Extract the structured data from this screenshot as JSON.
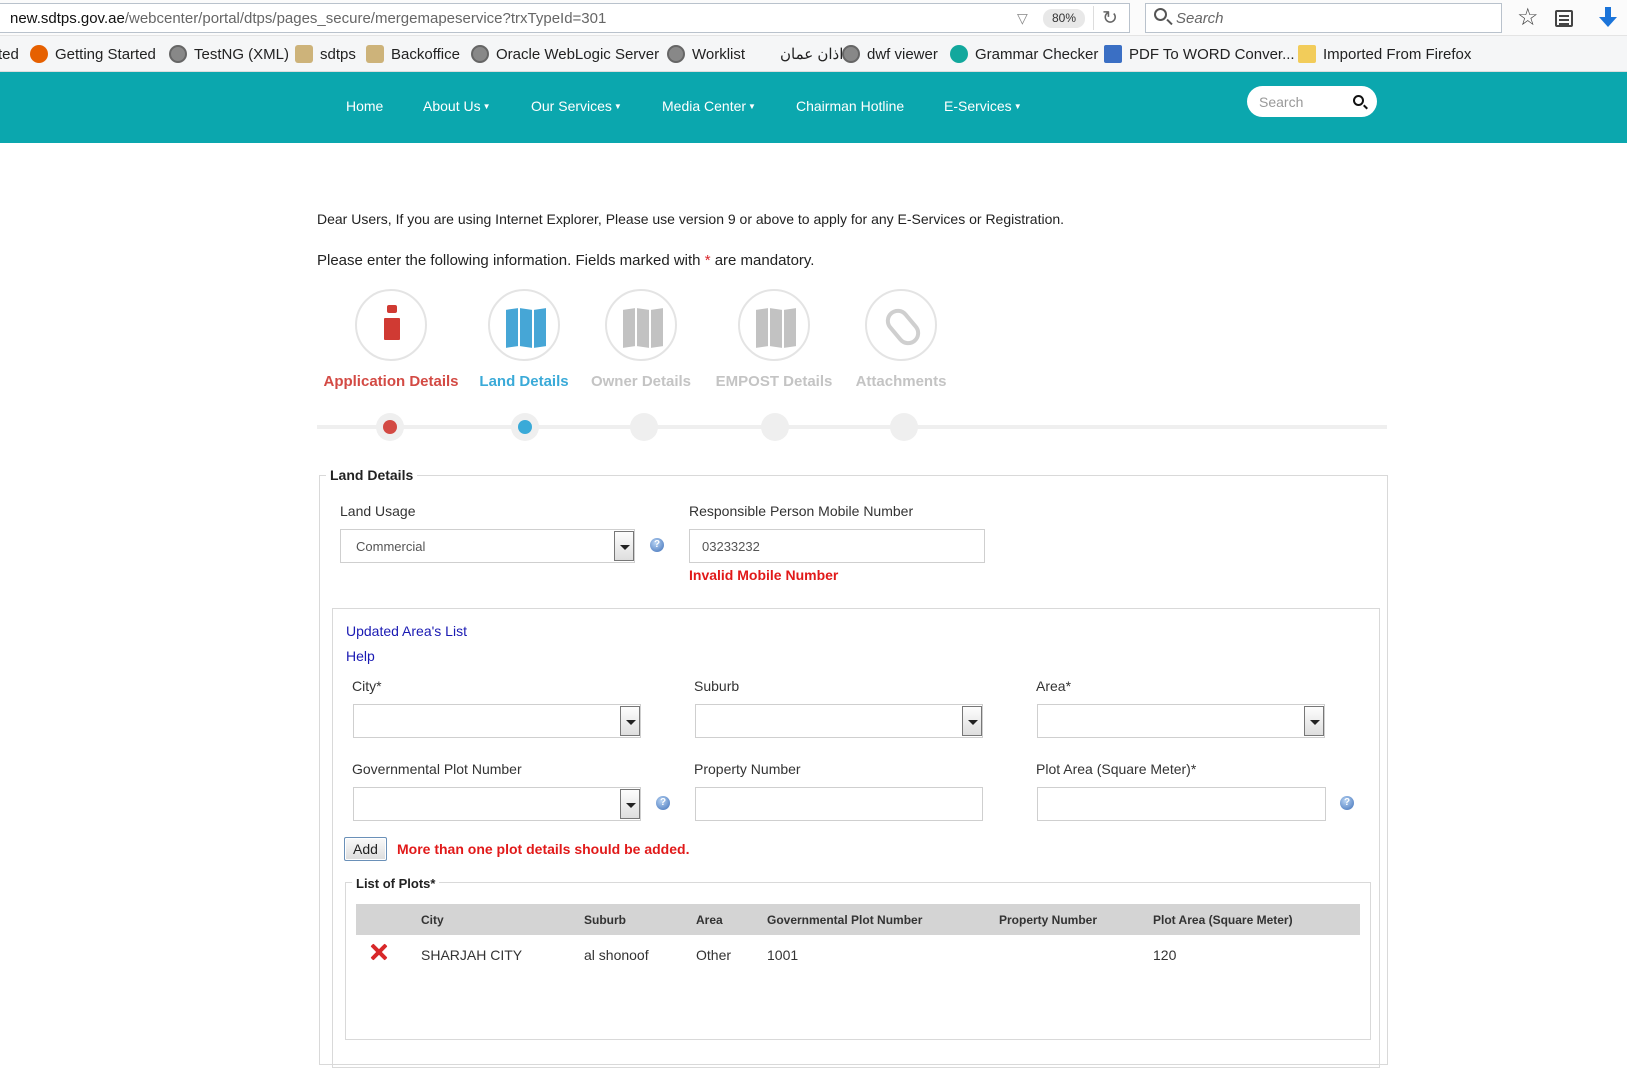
{
  "browser": {
    "url_host": "new.sdtps.gov.ae",
    "url_path": "/webcenter/portal/dtps/pages_secure/mergemapeservice?trxTypeId=301",
    "zoom": "80%",
    "search_placeholder": "Search"
  },
  "bookmarks": [
    {
      "label": "ted",
      "icon": "none"
    },
    {
      "label": "Getting Started",
      "icon": "firefox-icon"
    },
    {
      "label": "TestNG (XML)",
      "icon": "globe-icon"
    },
    {
      "label": "sdtps",
      "icon": "crest-icon"
    },
    {
      "label": "Backoffice",
      "icon": "crest-icon"
    },
    {
      "label": "Oracle WebLogic Server",
      "icon": "globe-icon"
    },
    {
      "label": "Worklist",
      "icon": "globe-icon"
    },
    {
      "label": "اذان عمان",
      "icon": "none"
    },
    {
      "label": "dwf viewer",
      "icon": "globe-icon"
    },
    {
      "label": "Grammar Checker",
      "icon": "grammar-icon"
    },
    {
      "label": "PDF To WORD Conver...",
      "icon": "pdf-icon"
    },
    {
      "label": "Imported From Firefox",
      "icon": "folder-icon"
    }
  ],
  "nav": {
    "home": "Home",
    "about": "About Us",
    "services": "Our Services",
    "media": "Media Center",
    "hotline": "Chairman Hotline",
    "eservices": "E-Services",
    "caret": "▼",
    "search_placeholder": "Search"
  },
  "notice": "Dear Users, If you are using Internet Explorer, Please use version 9 or above to apply for any E-Services or Registration.",
  "instruction": {
    "before": "Please enter the following information. Fields marked with ",
    "star": "*",
    "after": " are mandatory."
  },
  "steps": [
    {
      "label": "Application Details",
      "state": "done"
    },
    {
      "label": "Land Details",
      "state": "active"
    },
    {
      "label": "Owner Details",
      "state": "pending"
    },
    {
      "label": "EMPOST Details",
      "state": "pending"
    },
    {
      "label": "Attachments",
      "state": "pending"
    }
  ],
  "land_details": {
    "legend": "Land Details",
    "land_usage_label": "Land Usage",
    "land_usage_value": "Commercial",
    "mobile_label": "Responsible Person Mobile Number",
    "mobile_value": "03233232",
    "mobile_error": "Invalid Mobile Number"
  },
  "plot_form": {
    "updated_areas_link": "Updated Area's List",
    "help_link": "Help",
    "city_label": "City*",
    "suburb_label": "Suburb",
    "area_label": "Area*",
    "gov_plot_label": "Governmental Plot Number",
    "property_label": "Property Number",
    "plot_area_label": "Plot Area (Square Meter)*",
    "add_button": "Add",
    "add_error": "More than one plot details should be added."
  },
  "plots": {
    "legend": "List of Plots*",
    "columns": [
      "City",
      "Suburb",
      "Area",
      "Governmental Plot Number",
      "Property Number",
      "Plot Area (Square Meter)"
    ],
    "rows": [
      {
        "city": "SHARJAH CITY",
        "suburb": "al shonoof",
        "area": "Other",
        "gov_plot": "1001",
        "property": "",
        "plot_area": "120"
      }
    ]
  },
  "colors": {
    "nav_bg": "#0ba7ae",
    "step_done": "#d34a44",
    "step_active": "#3aaad8",
    "error": "#e11919"
  }
}
